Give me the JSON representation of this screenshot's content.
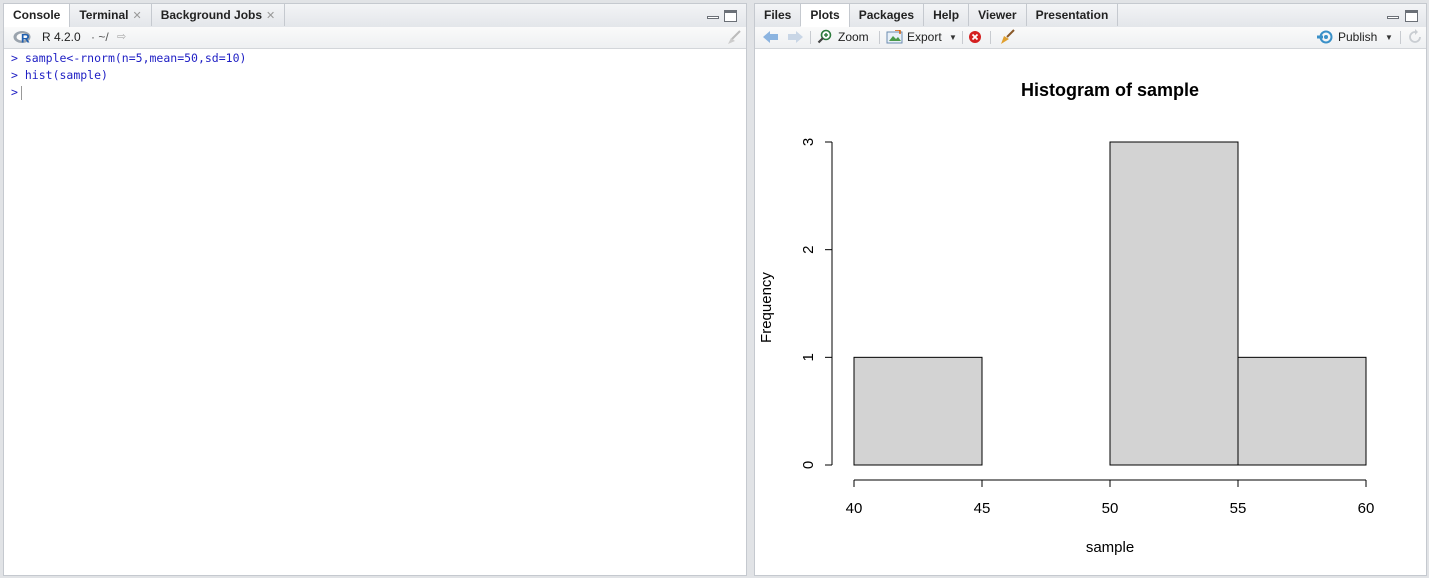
{
  "left_pane": {
    "tabs": [
      {
        "label": "Console",
        "closable": false,
        "active": true
      },
      {
        "label": "Terminal",
        "closable": true,
        "active": false
      },
      {
        "label": "Background Jobs",
        "closable": true,
        "active": false
      }
    ],
    "toolbar": {
      "r_version": "R 4.2.0",
      "path": "· ~/"
    },
    "console_lines": [
      {
        "prompt": ">",
        "text": "sample<-rnorm(n=5,mean=50,sd=10)"
      },
      {
        "prompt": ">",
        "text": "hist(sample)"
      },
      {
        "prompt": ">",
        "text": ""
      }
    ]
  },
  "right_pane": {
    "tabs": [
      {
        "label": "Files",
        "active": false
      },
      {
        "label": "Plots",
        "active": true
      },
      {
        "label": "Packages",
        "active": false
      },
      {
        "label": "Help",
        "active": false
      },
      {
        "label": "Viewer",
        "active": false
      },
      {
        "label": "Presentation",
        "active": false
      }
    ],
    "toolbar": {
      "zoom_label": "Zoom",
      "export_label": "Export",
      "publish_label": "Publish"
    }
  },
  "chart_data": {
    "type": "bar",
    "title": "Histogram of sample",
    "xlabel": "sample",
    "ylabel": "Frequency",
    "bins": [
      {
        "from": 40,
        "to": 45,
        "count": 1
      },
      {
        "from": 45,
        "to": 50,
        "count": 0
      },
      {
        "from": 50,
        "to": 55,
        "count": 3
      },
      {
        "from": 55,
        "to": 60,
        "count": 1
      }
    ],
    "x_ticks": [
      40,
      45,
      50,
      55,
      60
    ],
    "y_ticks": [
      0,
      1,
      2,
      3
    ],
    "xlim": [
      40,
      60
    ],
    "ylim": [
      0,
      3
    ],
    "bar_fill": "#d3d3d3",
    "grid": false
  }
}
